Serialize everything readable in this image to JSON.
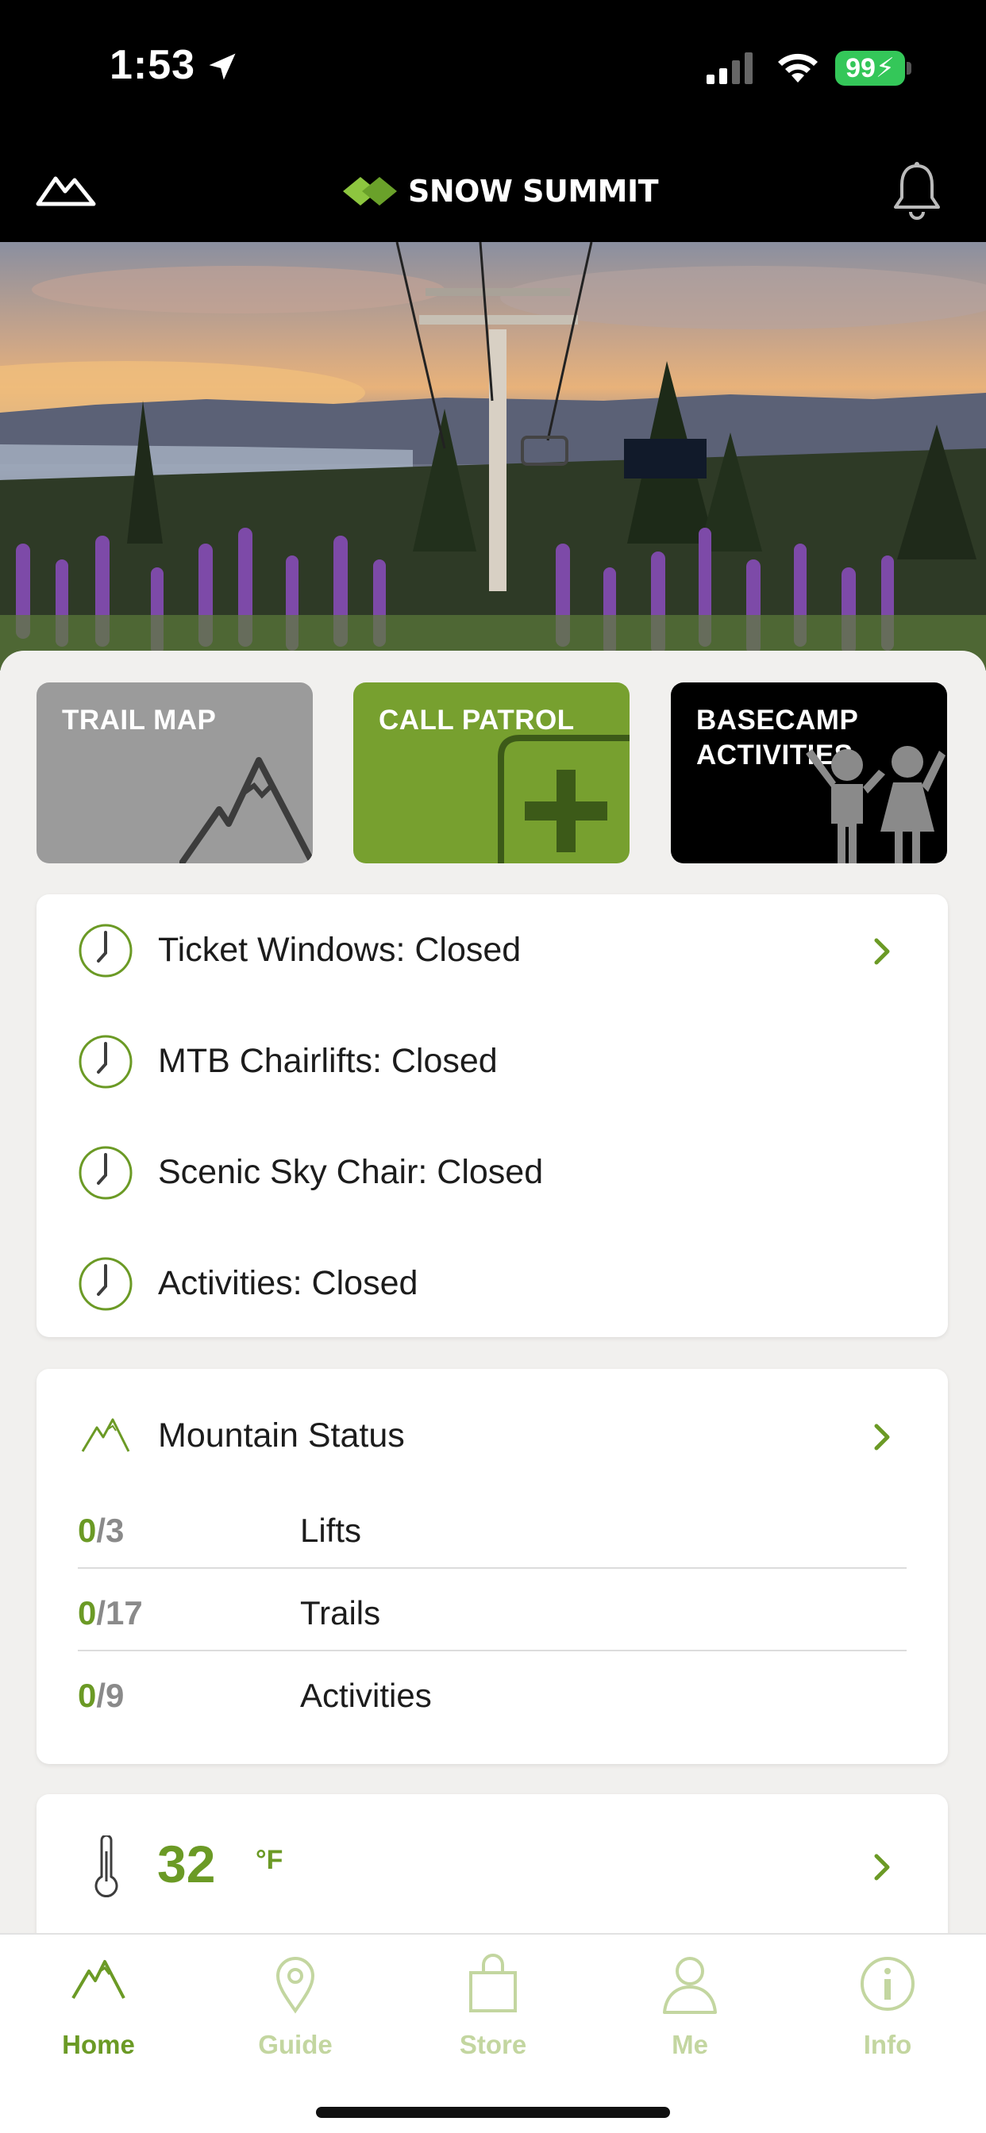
{
  "status_bar": {
    "time": "1:53",
    "battery": "99"
  },
  "header": {
    "brand": "SNOW SUMMIT"
  },
  "tiles": [
    {
      "label": "TRAIL MAP"
    },
    {
      "label": "CALL PATROL"
    },
    {
      "label": "BASECAMP\nACTIVITIES"
    }
  ],
  "hours": [
    {
      "label": "Ticket Windows: Closed"
    },
    {
      "label": "MTB Chairlifts: Closed"
    },
    {
      "label": "Scenic Sky Chair: Closed"
    },
    {
      "label": "Activities: Closed"
    }
  ],
  "mountain_status": {
    "title": "Mountain Status",
    "rows": [
      {
        "open": "0",
        "total": "/3",
        "name": "Lifts"
      },
      {
        "open": "0",
        "total": "/17",
        "name": "Trails"
      },
      {
        "open": "0",
        "total": "/9",
        "name": "Activities"
      }
    ]
  },
  "weather": {
    "temperature": "32",
    "unit": "°F"
  },
  "tabbar": [
    {
      "label": "Home"
    },
    {
      "label": "Guide"
    },
    {
      "label": "Store"
    },
    {
      "label": "Me"
    },
    {
      "label": "Info"
    }
  ],
  "colors": {
    "accent": "#6b9a25",
    "patrol_tile": "#77a02f",
    "trail_tile": "#9b9b9b",
    "inactive_tab": "#c3d6a0"
  }
}
